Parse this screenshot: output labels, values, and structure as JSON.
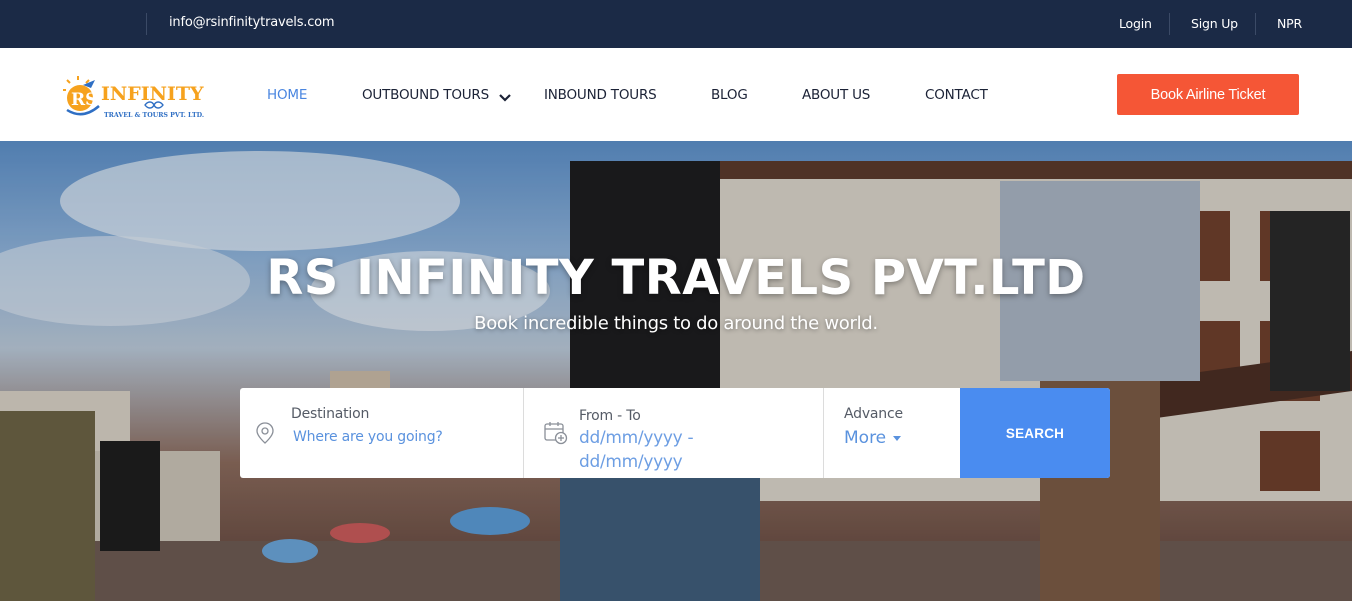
{
  "topbar": {
    "email": "info@rsinfinitytravels.com",
    "login": "Login",
    "signup": "Sign Up",
    "currency": "NPR"
  },
  "logo": {
    "initials": "RS",
    "name": "INFINITY",
    "tagline": "TRAVEL & TOURS PVT. LTD."
  },
  "nav": {
    "home": "HOME",
    "outbound": "OUTBOUND TOURS",
    "inbound": "INBOUND TOURS",
    "blog": "BLOG",
    "about": "ABOUT US",
    "contact": "CONTACT"
  },
  "cta": {
    "book_airline": "Book Airline Ticket"
  },
  "hero": {
    "title": "RS INFINITY TRAVELS PVT.LTD",
    "subtitle": "Book incredible things to do around the world."
  },
  "search": {
    "destination_label": "Destination",
    "destination_placeholder": "Where are you going?",
    "date_label": "From - To",
    "date_from": "dd/mm/yyyy -",
    "date_to": "dd/mm/yyyy",
    "advance_label": "Advance",
    "more_label": "More",
    "button": "SEARCH"
  },
  "colors": {
    "topbar": "#1b2a46",
    "accent": "#4a86e0",
    "cta": "#f55636",
    "search_button": "#4a8cf0"
  },
  "icons": [
    "chevron-down-icon",
    "map-pin-icon",
    "calendar-add-icon",
    "caret-down-icon"
  ]
}
